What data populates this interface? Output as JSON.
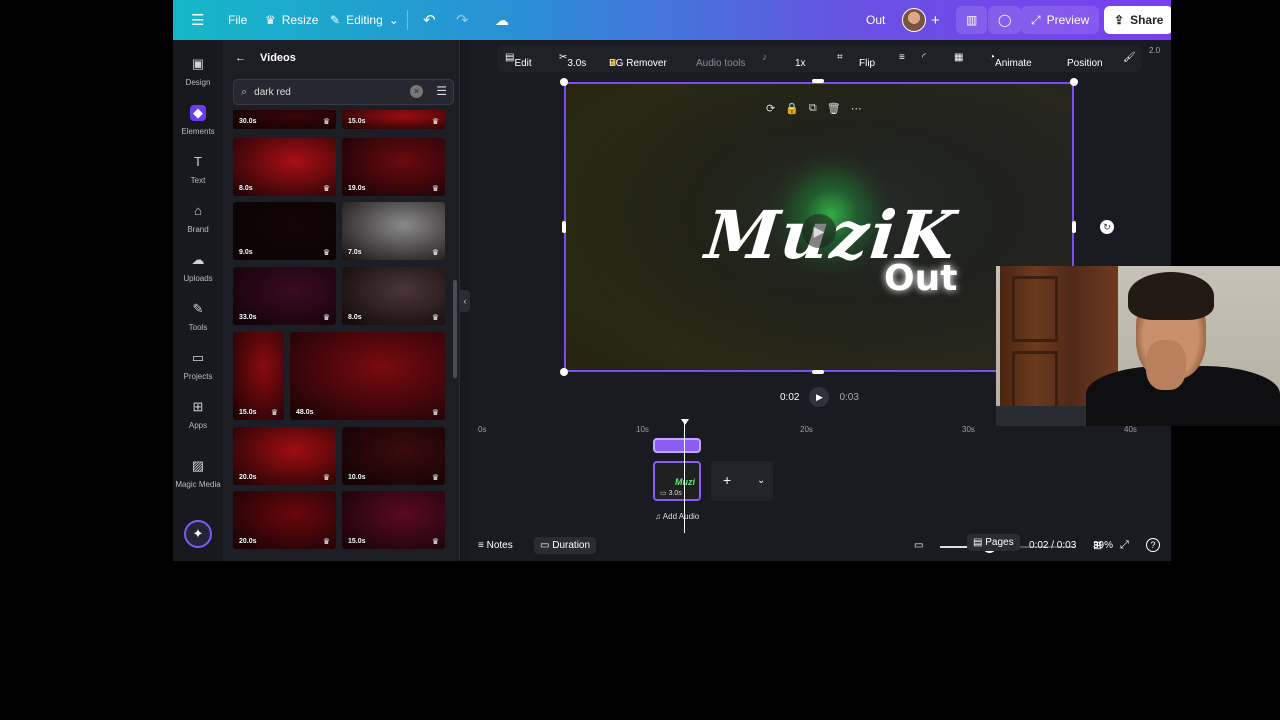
{
  "topbar": {
    "file_label": "File",
    "resize_label": "Resize",
    "editing_label": "Editing",
    "doc_title": "Out",
    "preview_label": "Preview",
    "share_label": "Share"
  },
  "rail": {
    "items": [
      {
        "label": "Design",
        "icon": "layout-icon"
      },
      {
        "label": "Elements",
        "icon": "shapes-icon"
      },
      {
        "label": "Text",
        "icon": "text-icon"
      },
      {
        "label": "Brand",
        "icon": "brand-icon"
      },
      {
        "label": "Uploads",
        "icon": "upload-cloud-icon"
      },
      {
        "label": "Tools",
        "icon": "pen-icon"
      },
      {
        "label": "Projects",
        "icon": "folder-icon"
      },
      {
        "label": "Apps",
        "icon": "apps-grid-icon"
      },
      {
        "label": "Magic Media",
        "icon": "magic-image-icon"
      }
    ]
  },
  "panel": {
    "title": "Videos",
    "search_value": "dark red",
    "thumbs": [
      {
        "duration": "30.0s",
        "color": "#3a0508"
      },
      {
        "duration": "15.0s",
        "color": "#9c0d12"
      },
      {
        "duration": "8.0s",
        "color": "#a80f16"
      },
      {
        "duration": "19.0s",
        "color": "#6a0a10"
      },
      {
        "duration": "9.0s",
        "color": "#120506"
      },
      {
        "duration": "7.0s",
        "color": "#8a8a8a"
      },
      {
        "duration": "33.0s",
        "color": "#3a0a24"
      },
      {
        "duration": "8.0s",
        "color": "#4a3638"
      },
      {
        "duration": "15.0s",
        "color": "#8a0a10"
      },
      {
        "duration": "48.0s",
        "color": "#7a0a10"
      },
      {
        "duration": "20.0s",
        "color": "#a00d12"
      },
      {
        "duration": "10.0s",
        "color": "#3a0a0c"
      },
      {
        "duration": "20.0s",
        "color": "#6a070c"
      },
      {
        "duration": "15.0s",
        "color": "#5a0a22"
      }
    ]
  },
  "context_toolbar": {
    "edit_label": "Edit",
    "trim_label": "3.0s",
    "bg_remover_label": "BG Remover",
    "audio_tools_label": "Audio tools",
    "speed_label": "1x",
    "flip_label": "Flip",
    "animate_label": "Animate",
    "position_label": "Position"
  },
  "zoom_badge": "2.0",
  "canvas": {
    "title_text": "MuziK",
    "sub_text": "Out"
  },
  "playback": {
    "current_time": "0:02",
    "total_time": "0:03"
  },
  "timeline": {
    "ruler": [
      "0s",
      "10s",
      "20s",
      "30s",
      "40s"
    ],
    "clip_text": "Muzi",
    "clip_duration": "3.0s",
    "add_audio_label": "Add Audio"
  },
  "footer": {
    "notes_label": "Notes",
    "duration_label": "Duration",
    "zoom_percent": "39%",
    "zoom_level": 0.39,
    "pages_label": "Pages",
    "time_readout": "0:02 / 0:03"
  },
  "colors": {
    "accent": "#7d4cf3",
    "topbar_start": "#14b8c8",
    "topbar_end": "#7a3ff0"
  }
}
